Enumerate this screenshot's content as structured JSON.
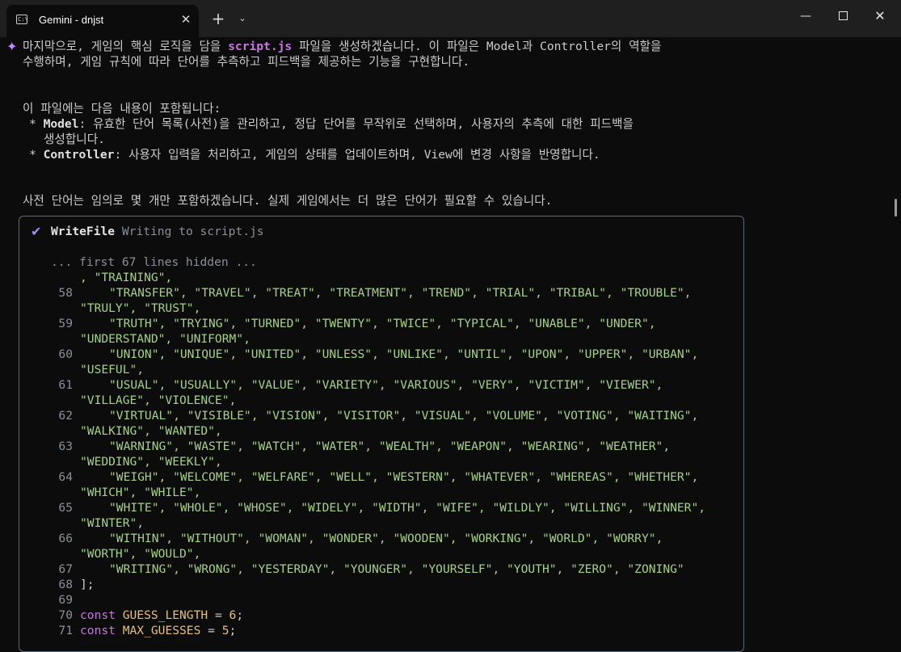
{
  "window": {
    "tab_title": "Gemini - dnjst",
    "tab_icon": "terminal-icon",
    "close_tab_glyph": "✕",
    "new_tab_glyph": "+",
    "dropdown_glyph": "⌄",
    "minimize_glyph": "—",
    "close_glyph": "✕"
  },
  "message": {
    "p1_a": "마지막으로, 게임의 핵심 로직을 담을 ",
    "p1_code": "script.js",
    "p1_b": " 파일을 생성하겠습니다. 이 파일은 Model과 Controller의 역할을",
    "p1_line2": "수행하며, 게임 규칙에 따라 단어를 추측하고 피드백을 제공하는 기능을 구현합니다.",
    "p2": "이 파일에는 다음 내용이 포함됩니다:",
    "bullet1_label": "Model",
    "bullet1_text": ": 유효한 단어 목록(사전)을 관리하고, 정답 단어를 무작위로 선택하며, 사용자의 추측에 대한 피드백을",
    "bullet1_cont": "생성합니다.",
    "bullet2_label": "Controller",
    "bullet2_text": ": 사용자 입력을 처리하고, 게임의 상태를 업데이트하며, View에 변경 사항을 반영합니다.",
    "p3": "사전 단어는 임의로 몇 개만 포함하겠습니다. 실제 게임에서는 더 많은 단어가 필요할 수 있습니다."
  },
  "tool": {
    "name": "WriteFile",
    "description": "Writing to script.js",
    "hidden_note": "... first 67 lines hidden ..."
  },
  "code": {
    "line_first": ", \"TRAINING\",",
    "rows": [
      {
        "num": "58",
        "a": "\"TRANSFER\", \"TRAVEL\", \"TREAT\", \"TREATMENT\", \"TREND\", \"TRIAL\", \"TRIBAL\", \"TROUBLE\",",
        "b": "\"TRULY\", \"TRUST\","
      },
      {
        "num": "59",
        "a": "\"TRUTH\", \"TRYING\", \"TURNED\", \"TWENTY\", \"TWICE\", \"TYPICAL\", \"UNABLE\", \"UNDER\",",
        "b": "\"UNDERSTAND\", \"UNIFORM\","
      },
      {
        "num": "60",
        "a": "\"UNION\", \"UNIQUE\", \"UNITED\", \"UNLESS\", \"UNLIKE\", \"UNTIL\", \"UPON\", \"UPPER\", \"URBAN\",",
        "b": "\"USEFUL\","
      },
      {
        "num": "61",
        "a": "\"USUAL\", \"USUALLY\", \"VALUE\", \"VARIETY\", \"VARIOUS\", \"VERY\", \"VICTIM\", \"VIEWER\",",
        "b": "\"VILLAGE\", \"VIOLENCE\","
      },
      {
        "num": "62",
        "a": "\"VIRTUAL\", \"VISIBLE\", \"VISION\", \"VISITOR\", \"VISUAL\", \"VOLUME\", \"VOTING\", \"WAITING\",",
        "b": "\"WALKING\", \"WANTED\","
      },
      {
        "num": "63",
        "a": "\"WARNING\", \"WASTE\", \"WATCH\", \"WATER\", \"WEALTH\", \"WEAPON\", \"WEARING\", \"WEATHER\",",
        "b": "\"WEDDING\", \"WEEKLY\","
      },
      {
        "num": "64",
        "a": "\"WEIGH\", \"WELCOME\", \"WELFARE\", \"WELL\", \"WESTERN\", \"WHATEVER\", \"WHEREAS\", \"WHETHER\",",
        "b": "\"WHICH\", \"WHILE\","
      },
      {
        "num": "65",
        "a": "\"WHITE\", \"WHOLE\", \"WHOSE\", \"WIDELY\", \"WIDTH\", \"WIFE\", \"WILDLY\", \"WILLING\", \"WINNER\",",
        "b": "\"WINTER\","
      },
      {
        "num": "66",
        "a": "\"WITHIN\", \"WITHOUT\", \"WOMAN\", \"WONDER\", \"WOODEN\", \"WORKING\", \"WORLD\", \"WORRY\",",
        "b": "\"WORTH\", \"WOULD\","
      },
      {
        "num": "67",
        "a": "\"WRITING\", \"WRONG\", \"YESTERDAY\", \"YOUNGER\", \"YOURSELF\", \"YOUTH\", \"ZERO\", \"ZONING\"",
        "b": ""
      }
    ],
    "line68_num": "68",
    "line68": "];",
    "line69_num": "69",
    "line70_num": "70",
    "line70_kw": "const",
    "line70_id": "GUESS_LENGTH",
    "line70_op": " = ",
    "line70_val": "6",
    "line70_end": ";",
    "line71_num": "71",
    "line71_kw": "const",
    "line71_id": "MAX_GUESSES",
    "line71_op": " = ",
    "line71_val": "5",
    "line71_end": ";"
  },
  "colors": {
    "background": "#0c0c0c",
    "accent": "#c58af9",
    "string": "#a6d189",
    "keyword": "#c678dd"
  }
}
